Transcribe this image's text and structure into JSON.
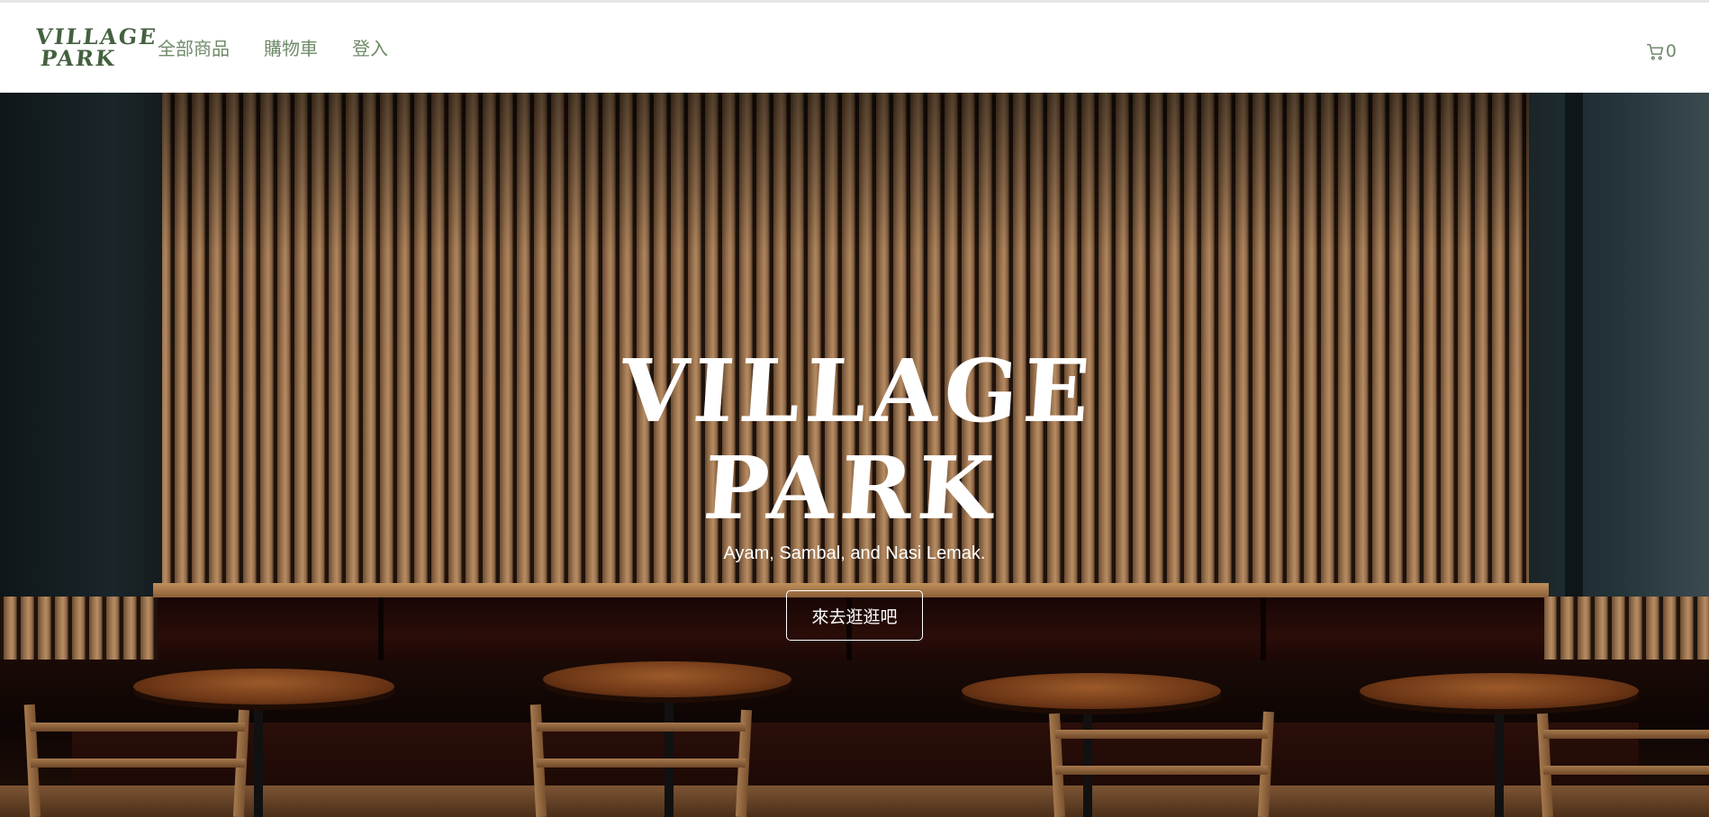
{
  "brand": {
    "logo_line1": "VILLAGE",
    "logo_line2": "PARK",
    "color": "#44613f"
  },
  "nav": {
    "links": [
      {
        "label": "全部商品"
      },
      {
        "label": "購物車"
      },
      {
        "label": "登入"
      }
    ],
    "link_color": "#6f8a69",
    "cart": {
      "icon": "cart-icon",
      "count": "0"
    }
  },
  "hero": {
    "title_line1": "VILLAGE",
    "title_line2": "PARK",
    "subtitle": "Ayam, Sambal, and Nasi Lemak.",
    "cta_label": "來去逛逛吧",
    "text_color": "#ffffff"
  }
}
